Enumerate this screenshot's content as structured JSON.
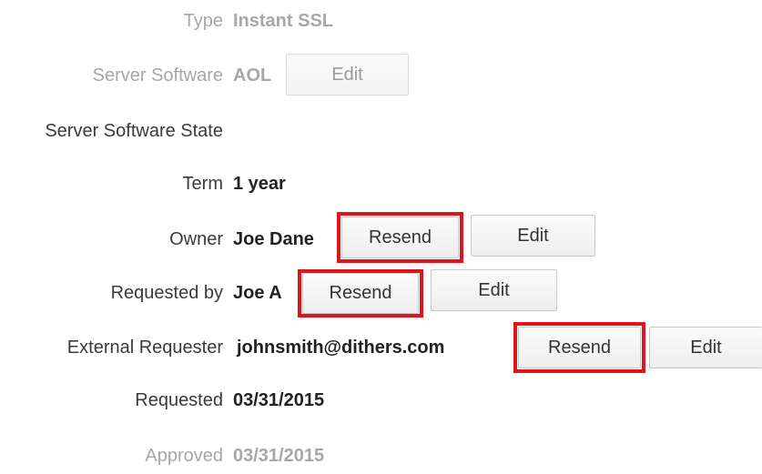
{
  "fields": {
    "type": {
      "label": "Type",
      "value": "Instant SSL"
    },
    "server_software": {
      "label": "Server Software",
      "value": "AOL",
      "edit_label": "Edit"
    },
    "server_software_state": {
      "label": "Server Software State",
      "value": ""
    },
    "term": {
      "label": "Term",
      "value": "1 year"
    },
    "owner": {
      "label": "Owner",
      "value": "Joe Dane",
      "resend_label": "Resend",
      "edit_label": "Edit"
    },
    "requested_by": {
      "label": "Requested by",
      "value": "Joe A",
      "resend_label": "Resend",
      "edit_label": "Edit"
    },
    "external_requester": {
      "label": "External Requester",
      "value": "johnsmith@dithers.com",
      "resend_label": "Resend",
      "edit_label": "Edit"
    },
    "requested": {
      "label": "Requested",
      "value": "03/31/2015"
    },
    "approved": {
      "label": "Approved",
      "value": "03/31/2015"
    }
  },
  "colors": {
    "highlight": "#e0151b",
    "muted_text": "#a7a7a7"
  }
}
